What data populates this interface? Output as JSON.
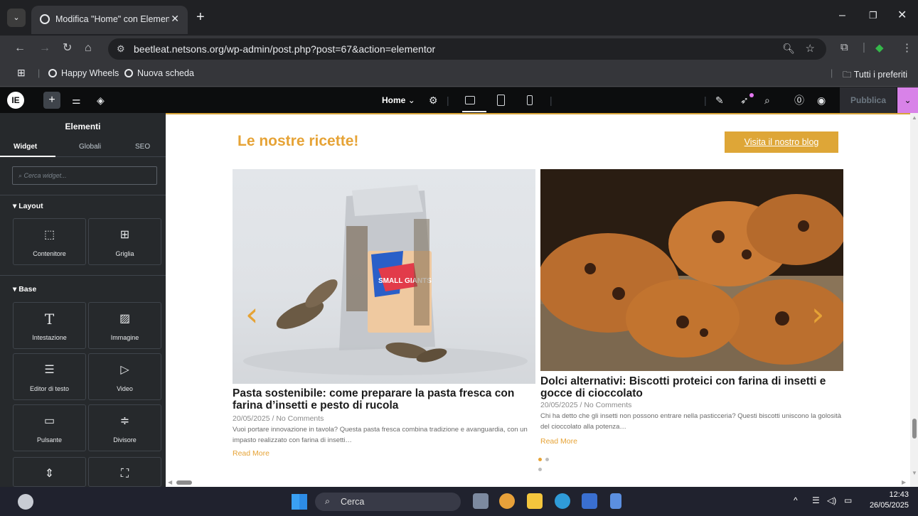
{
  "browser": {
    "tab_title": "Modifica \"Home\" con Elementor",
    "url": "beetleat.netsons.org/wp-admin/post.php?post=67&action=elementor",
    "bookmarks": [
      "Happy Wheels",
      "Nuova scheda"
    ],
    "all_bookmarks": "Tutti i preferiti"
  },
  "editor": {
    "page_name": "Home",
    "publish_label": "Pubblica"
  },
  "panel": {
    "title": "Elementi",
    "tabs": [
      "Widget",
      "Globali",
      "SEO"
    ],
    "search_placeholder": "Cerca widget...",
    "sections": [
      {
        "label": "Layout",
        "widgets": [
          {
            "label": "Contenitore",
            "icon": "container-icon"
          },
          {
            "label": "Griglia",
            "icon": "grid-icon"
          }
        ]
      },
      {
        "label": "Base",
        "widgets": [
          {
            "label": "Intestazione",
            "icon": "heading-icon"
          },
          {
            "label": "Immagine",
            "icon": "image-icon"
          },
          {
            "label": "Editor di testo",
            "icon": "text-editor-icon"
          },
          {
            "label": "Video",
            "icon": "video-icon"
          },
          {
            "label": "Pulsante",
            "icon": "button-icon"
          },
          {
            "label": "Divisore",
            "icon": "divider-icon"
          },
          {
            "label": "",
            "icon": "spacer-icon"
          },
          {
            "label": "",
            "icon": "image-box-icon"
          }
        ]
      }
    ]
  },
  "page": {
    "heading": "Le nostre ricette!",
    "blog_button": "Visita il nostro blog",
    "accent_color": "#e6a336",
    "posts": [
      {
        "title": "Pasta sostenibile: come preparare la pasta fresca con farina d’insetti e pesto di rucola",
        "date": "20/05/2025",
        "comments": "No Comments",
        "excerpt": "Vuoi portare innovazione in tavola? Questa pasta fresca combina tradizione e avanguardia, con un impasto realizzato con farina di insetti…",
        "read_more": "Read More",
        "package_text": "SMALL GIANTS"
      },
      {
        "title": "Dolci alternativi: Biscotti proteici con farina di insetti e gocce di cioccolato",
        "date": "20/05/2025",
        "comments": "No Comments",
        "excerpt": "Chi ha detto che gli insetti non possono entrare nella pasticceria? Questi biscotti uniscono la golosità del cioccolato alla potenza…",
        "read_more": "Read More"
      }
    ]
  },
  "taskbar": {
    "search_label": "Cerca",
    "time": "12:43",
    "date": "26/05/2025"
  }
}
